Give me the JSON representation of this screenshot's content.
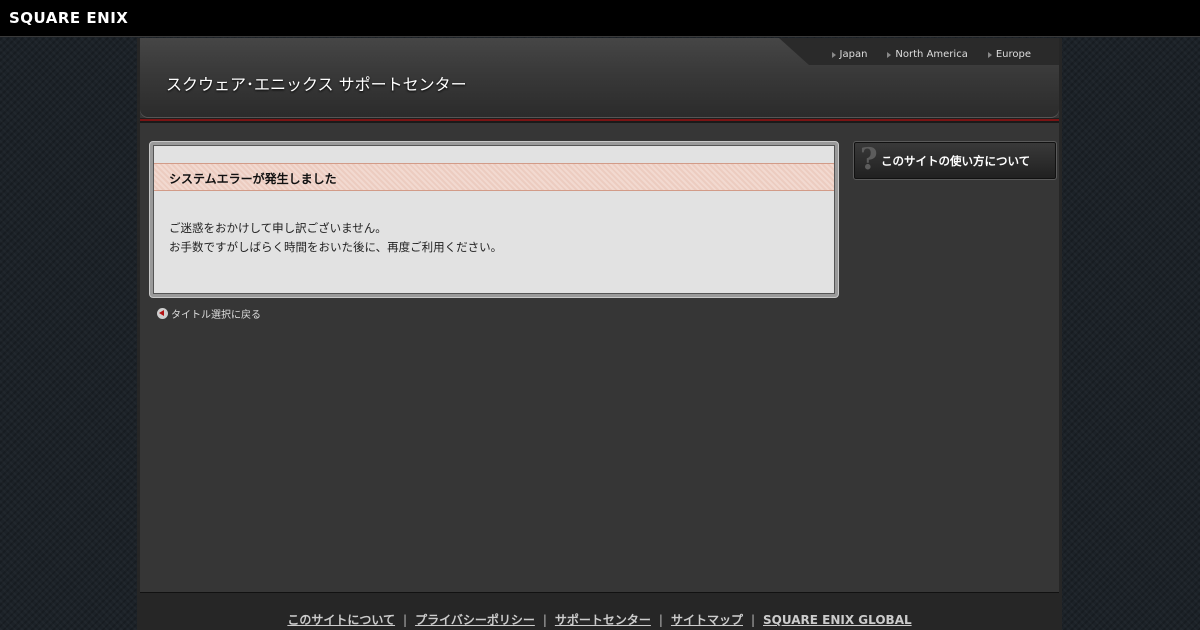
{
  "brand": {
    "logo": "SQUARE ENIX"
  },
  "header": {
    "site_title": "スクウェア･エニックス サポートセンター",
    "regions": [
      "Japan",
      "North America",
      "Europe"
    ]
  },
  "error": {
    "title": "システムエラーが発生しました",
    "line1": "ご迷惑をおかけして申し訳ございません。",
    "line2": "お手数ですがしばらく時間をおいた後に、再度ご利用ください。"
  },
  "back_link": "タイトル選択に戻る",
  "help_button": {
    "label": "このサイトの使い方について",
    "icon_char": "?"
  },
  "footer": {
    "links": [
      "このサイトについて",
      "プライバシーポリシー",
      "サポートセンター",
      "サイトマップ",
      "SQUARE ENIX GLOBAL"
    ],
    "separator": "|"
  },
  "colors": {
    "accent_red": "#7a1414",
    "error_header_bg": "#f2d9d0"
  }
}
